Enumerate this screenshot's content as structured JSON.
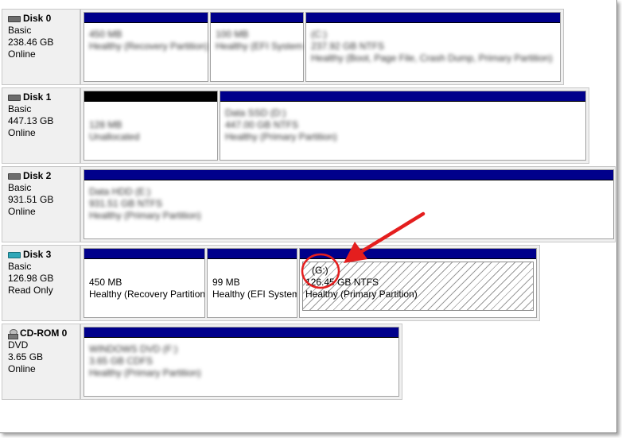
{
  "disks": [
    {
      "name": "Disk 0",
      "type": "Basic",
      "size": "238.46 GB",
      "status": "Online",
      "icon": "hard-disk-icon",
      "partitions": [
        {
          "line1": "450 MB",
          "line2": "Healthy (Recovery Partition)",
          "line3": ""
        },
        {
          "line1": "100 MB",
          "line2": "Healthy (EFI System",
          "line3": ""
        },
        {
          "line1": "(C:)",
          "line2": "237.92 GB NTFS",
          "line3": "Healthy (Boot, Page File, Crash Dump, Primary Partition)"
        }
      ]
    },
    {
      "name": "Disk 1",
      "type": "Basic",
      "size": "447.13 GB",
      "status": "Online",
      "icon": "hard-disk-icon",
      "partitions": [
        {
          "line1": "128 MB",
          "line2": "Unallocated",
          "line3": ""
        },
        {
          "line1": "Data SSD (D:)",
          "line2": "447.00 GB NTFS",
          "line3": "Healthy (Primary Partition)"
        }
      ]
    },
    {
      "name": "Disk 2",
      "type": "Basic",
      "size": "931.51 GB",
      "status": "Online",
      "icon": "hard-disk-icon",
      "partitions": [
        {
          "line1": "Data HDD (E:)",
          "line2": "931.51 GB NTFS",
          "line3": "Healthy (Primary Partition)"
        }
      ]
    },
    {
      "name": "Disk 3",
      "type": "Basic",
      "size": "126.98 GB",
      "status": "Read Only",
      "icon": "removable-disk-icon",
      "partitions": [
        {
          "line1": "450 MB",
          "line2": "Healthy (Recovery Partition",
          "line3": ""
        },
        {
          "line1": "99 MB",
          "line2": "Healthy (EFI System",
          "line3": ""
        },
        {
          "line1": "(G:)",
          "line2": "126.45 GB NTFS",
          "line3": "Healthy (Primary Partition)"
        }
      ]
    },
    {
      "name": "CD-ROM 0",
      "type": "DVD",
      "size": "3.65 GB",
      "status": "Online",
      "icon": "cd-rom-icon",
      "partitions": [
        {
          "line1": "WINDOWS DVD (F:)",
          "line2": "3.65 GB CDFS",
          "line3": "Healthy (Primary Partition)"
        }
      ]
    }
  ],
  "colors": {
    "partition_bar": "#00008b",
    "unallocated_bar": "#000000",
    "annotation": "#e41e1e"
  }
}
